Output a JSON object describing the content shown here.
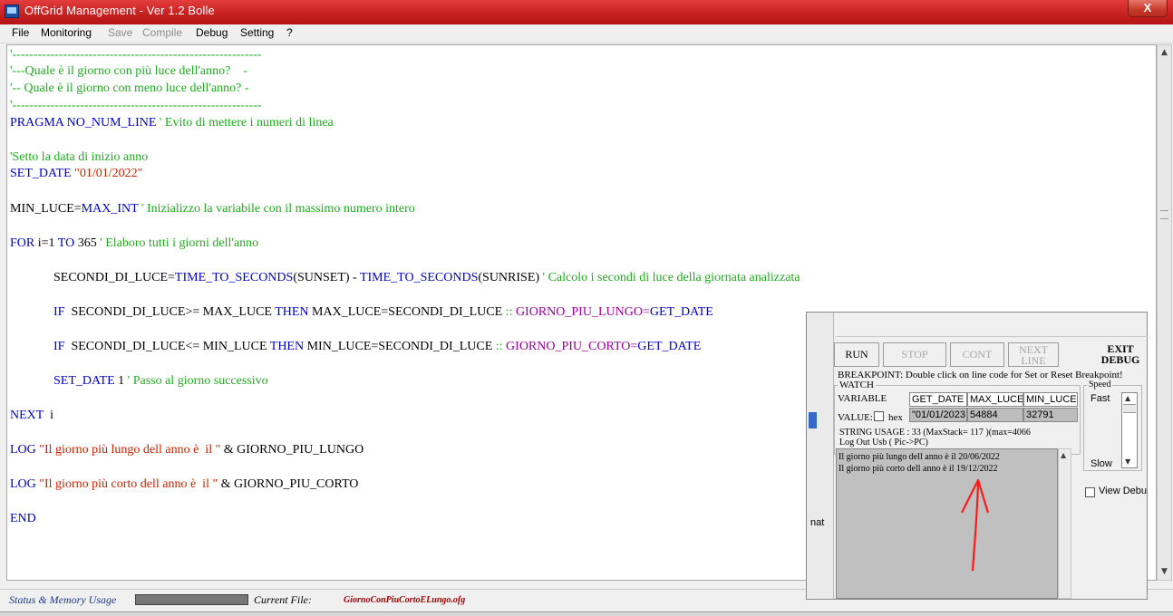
{
  "window": {
    "title": "OffGrid Management - Ver 1.2 Bolle",
    "close_label": "X"
  },
  "menu": [
    {
      "label": "File",
      "disabled": false
    },
    {
      "label": "Monitoring",
      "disabled": false
    },
    {
      "label": "Save",
      "disabled": true
    },
    {
      "label": "Compile",
      "disabled": true
    },
    {
      "label": "Debug",
      "disabled": false
    },
    {
      "label": "Setting",
      "disabled": false
    },
    {
      "label": "?",
      "disabled": false
    }
  ],
  "code": {
    "l01": "'-----------------------------------------------------------",
    "l02": "'---Quale è il giorno con più luce dell'anno?    -",
    "l03": "'-- Quale è il giorno con meno luce dell'anno? -",
    "l04": "'-----------------------------------------------------------",
    "l05_kw": "PRAGMA NO_NUM_LINE",
    "l05_cm": " ' Evito di mettere i numeri di linea",
    "l06": "'Setto la data di inizio anno",
    "l07_kw": "SET_DATE ",
    "l07_str": "\"01/01/2022\"",
    "l08_var": "MIN_LUCE=",
    "l08_kw": "MAX_INT",
    "l08_cm": " ' Inizializzo la variabile con il massimo numero intero",
    "l09_kw1": "FOR ",
    "l09_var": "i=1 ",
    "l09_kw2": "TO ",
    "l09_num": "365",
    "l09_cm": " ' Elaboro tutti i giorni dell'anno",
    "l10_a": "SECONDI_DI_LUCE=",
    "l10_b": "TIME_TO_SECONDS",
    "l10_c": "(SUNSET) - ",
    "l10_d": "TIME_TO_SECONDS",
    "l10_e": "(SUNRISE)",
    "l10_cm": " ' Calcolo i secondi di luce della giornata analizzata",
    "l11_if": "IF ",
    "l11_a": " SECONDI_DI_LUCE>= MAX_LUCE ",
    "l11_then": "THEN",
    "l11_b": " MAX_LUCE=SECONDI_DI_LUCE ",
    "l11_sep": "::",
    "l11_c": " GIORNO_PIU_LUNGO=",
    "l11_d": "GET_DATE",
    "l12_if": "IF ",
    "l12_a": " SECONDI_DI_LUCE<= MIN_LUCE ",
    "l12_then": "THEN",
    "l12_b": " MIN_LUCE=SECONDI_DI_LUCE ",
    "l12_sep": "::",
    "l12_c": " GIORNO_PIU_CORTO=",
    "l12_d": "GET_DATE",
    "l13_kw": "SET_DATE",
    "l13_num": " 1",
    "l13_cm": " ' Passo al giorno successivo",
    "l14_kw": "NEXT",
    "l14_var": "  i",
    "l15_kw": "LOG ",
    "l15_str": "\"Il giorno più lungo dell anno è  il \"",
    "l15_rest": " & GIORNO_PIU_LUNGO",
    "l16_kw": "LOG ",
    "l16_str": "\"Il giorno più corto dell anno è  il \"",
    "l16_rest": " & GIORNO_PIU_CORTO",
    "l17_kw": "END"
  },
  "status": {
    "label": "Status & Memory Usage",
    "current_file_label": "Current File:",
    "current_file": "GiornoConPiuCortoELungo.ofg"
  },
  "debug": {
    "run": "RUN",
    "stop": "STOP",
    "cont": "CONT",
    "next_line_1": "NEXT",
    "next_line_2": "LINE",
    "exit_1": "EXIT",
    "exit_2": "DEBUG",
    "breakpoint_hint": "BREAKPOINT: Double click on line code for Set or Reset Breakpoint!",
    "watch_title": "WATCH",
    "variable_label": "VARIABLE",
    "value_label": "VALUE:",
    "hex_label": "hex",
    "watch_vars": [
      "GET_DATE",
      "MAX_LUCE",
      "MIN_LUCE"
    ],
    "watch_values": [
      "\"01/01/2023",
      "54884",
      "32791"
    ],
    "string_usage": "STRING USAGE   :     33  (MaxStack=  117 )(max=4066",
    "log_out_label": "Log  Out Usb ( Pic->PC)",
    "log_lines": [
      "Il giorno più lungo dell anno è  il 20/06/2022",
      "Il giorno più corto dell anno è  il 19/12/2022"
    ],
    "speed_title": "Speed",
    "speed_fast": "Fast",
    "speed_slow": "Slow",
    "view_debug_label": "View Debu",
    "side_fragment": "nat"
  },
  "colors": {
    "comment": "#22aa22",
    "keyword": "#0000cc",
    "string": "#cc2200",
    "purple": "#990099",
    "annotation_arrow": "#ff1a1a"
  }
}
